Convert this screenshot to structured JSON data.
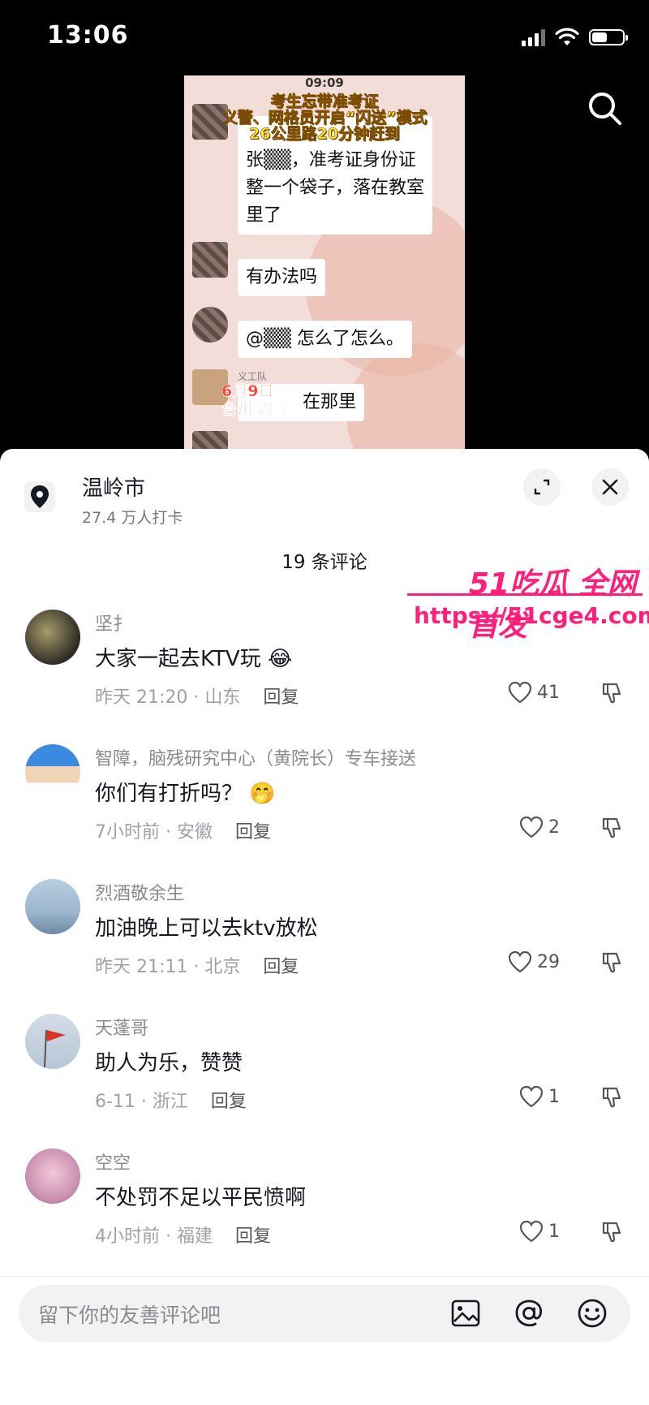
{
  "status": {
    "time": "13:06"
  },
  "video": {
    "clock": "09:09",
    "headline": [
      "考生忘带准考证",
      "义警、网格员开启“闪送”模式",
      "26公里路20分钟赶到"
    ],
    "messages": [
      {
        "text_lines": [
          "张▒▒，准考证身份证",
          "整一个袋子，落在教室",
          "里了"
        ]
      },
      {
        "text_lines": [
          "有办法吗"
        ]
      },
      {
        "text_lines": [
          "@▒▒ 怎么了怎么。"
        ]
      },
      {
        "name": "义工队",
        "text_lines": [
          "在那里"
        ]
      }
    ],
    "date_overlay": [
      "6月9日",
      "台州 温岭"
    ]
  },
  "location": {
    "name": "温岭市",
    "checkins": "27.4 万人打卡"
  },
  "comments_header": "19 条评论",
  "comments": [
    {
      "name": "坚扌",
      "text": "大家一起去KTV玩 😂",
      "meta": "昨天 21:20 · 山东",
      "reply": "回复",
      "likes": "41",
      "avatar_color": "#3b3a2e"
    },
    {
      "name": "智障，脑残研究中心（黄院长）专车接送",
      "text": "你们有打折吗？ 🤭",
      "meta": "7小时前 · 安徽",
      "reply": "回复",
      "likes": "2",
      "avatar_color": "#2a7bd5"
    },
    {
      "name": "烈酒敬余生",
      "text": "加油晚上可以去ktv放松",
      "meta": "昨天 21:11 · 北京",
      "reply": "回复",
      "likes": "29",
      "avatar_color": "#8ea8c6"
    },
    {
      "name": "天蓬哥",
      "text": "助人为乐，赞赞",
      "meta": "6-11 · 浙江",
      "reply": "回复",
      "likes": "1",
      "avatar_color": "#c7d3e0"
    },
    {
      "name": "空空",
      "text": "不处罚不足以平民愤啊",
      "meta": "4小时前 · 福建",
      "reply": "回复",
      "likes": "1",
      "avatar_color": "#d9b8d0"
    }
  ],
  "input": {
    "placeholder": "留下你的友善评论吧"
  },
  "watermark": {
    "line1": "51吃瓜 全网首发",
    "line2": "https://51cge4.com"
  }
}
